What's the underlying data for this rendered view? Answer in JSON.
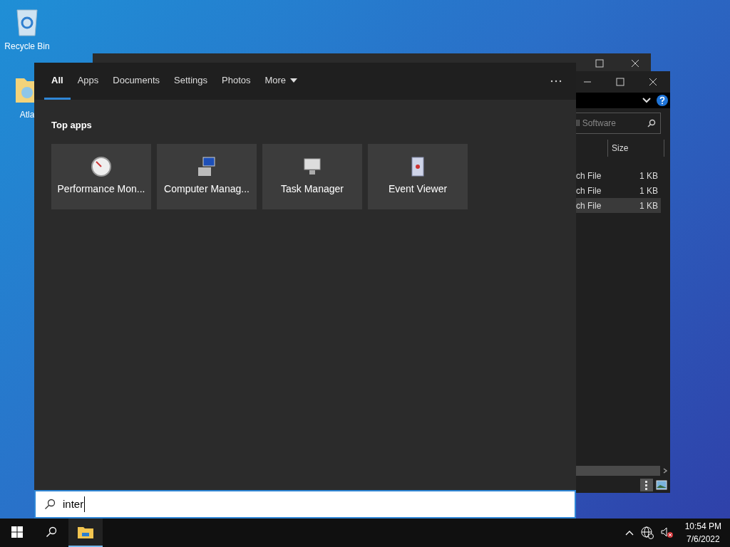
{
  "desktop_icons": [
    {
      "label": "Recycle Bin",
      "kind": "bin"
    },
    {
      "label": "Atla",
      "kind": "folder"
    }
  ],
  "explorer_window": {
    "search_placeholder": "ll Software",
    "columns": [
      "Size"
    ],
    "rows": [
      {
        "type": "ch File",
        "size": "1 KB",
        "selected": false
      },
      {
        "type": "ch File",
        "size": "1 KB",
        "selected": false
      },
      {
        "type": "ch File",
        "size": "1 KB",
        "selected": true
      }
    ]
  },
  "search_panel": {
    "tabs": [
      {
        "label": "All",
        "selected": true,
        "kind": "tab"
      },
      {
        "label": "Apps",
        "selected": false,
        "kind": "tab"
      },
      {
        "label": "Documents",
        "selected": false,
        "kind": "tab"
      },
      {
        "label": "Settings",
        "selected": false,
        "kind": "tab"
      },
      {
        "label": "Photos",
        "selected": false,
        "kind": "tab"
      },
      {
        "label": "More",
        "selected": false,
        "kind": "dropdown"
      }
    ],
    "section_title": "Top apps",
    "apps": [
      {
        "name": "Performance Mon...",
        "kind": "gauge"
      },
      {
        "name": "Computer Manag...",
        "kind": "computer"
      },
      {
        "name": "Task Manager",
        "kind": "monitor"
      },
      {
        "name": "Event Viewer",
        "kind": "log"
      }
    ],
    "search_value": "inter"
  },
  "taskbar": {
    "items": [
      {
        "kind": "start",
        "selected": false
      },
      {
        "kind": "search",
        "selected": false
      },
      {
        "kind": "explorer",
        "selected": true
      }
    ],
    "time": "10:54 PM",
    "date": "7/6/2022"
  }
}
